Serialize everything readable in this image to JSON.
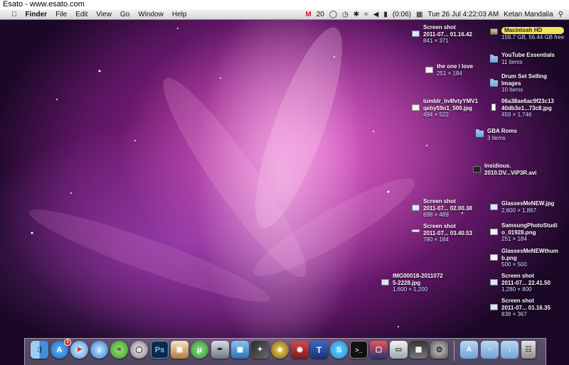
{
  "watermark": "Esato - www.esato.com",
  "menubar": {
    "app_name": "Finder",
    "menus": [
      "File",
      "Edit",
      "View",
      "Go",
      "Window",
      "Help"
    ],
    "gmail_count": "20",
    "battery_time": "(0:06)",
    "datetime": "Tue 26 Jul  4:22:03 AM",
    "user": "Ketan Mandalia"
  },
  "desktop_items": [
    {
      "name": "Screen shot\n2011-07... 01.16.42",
      "info": "841 × 371"
    },
    {
      "name": "Macintosh HD",
      "info": "159.7 GB, 56.44 GB free"
    },
    {
      "name": "YouTube Essentials",
      "info": "11 items"
    },
    {
      "name": "the one i love",
      "info": "251 × 184"
    },
    {
      "name": "Drum Set Selling\nImages",
      "info": "10 items"
    },
    {
      "name": "tumblr_ln4fvtyYMV1\nqeby59o1_500.jpg",
      "info": "494 × 522"
    },
    {
      "name": "06a38ae6ac9f23c13\n40db3e1...73c8.jpg",
      "info": "459 × 1,746"
    },
    {
      "name": "GBA Roms",
      "info": "3 items"
    },
    {
      "name": "Insidious.\n2010.DV...ViP3R.avi",
      "info": ""
    },
    {
      "name": "Screen shot\n2011-07... 02.00.38",
      "info": "698 × 489"
    },
    {
      "name": "GlassesMeNEW.jpg",
      "info": "2,800 × 1,867"
    },
    {
      "name": "Screen shot\n2011-07... 03.40.53",
      "info": "780 × 184"
    },
    {
      "name": "SamsungPhotoStudi\no_01928.png",
      "info": "251 × 184"
    },
    {
      "name": "GlassesMeNEWthum\nb.png",
      "info": "500 × 500"
    },
    {
      "name": "IMG00018-2011072\n5-2228.jpg",
      "info": "1,600 × 1,200"
    },
    {
      "name": "Screen shot\n2011-07... 22.41.50",
      "info": "1,280 × 800"
    },
    {
      "name": "Screen shot\n2011-07... 01.16.35",
      "info": "838 × 367"
    }
  ],
  "dock": {
    "app_store_badge": "2",
    "photoshop_label": "Ps",
    "typesetter_label": "T"
  }
}
